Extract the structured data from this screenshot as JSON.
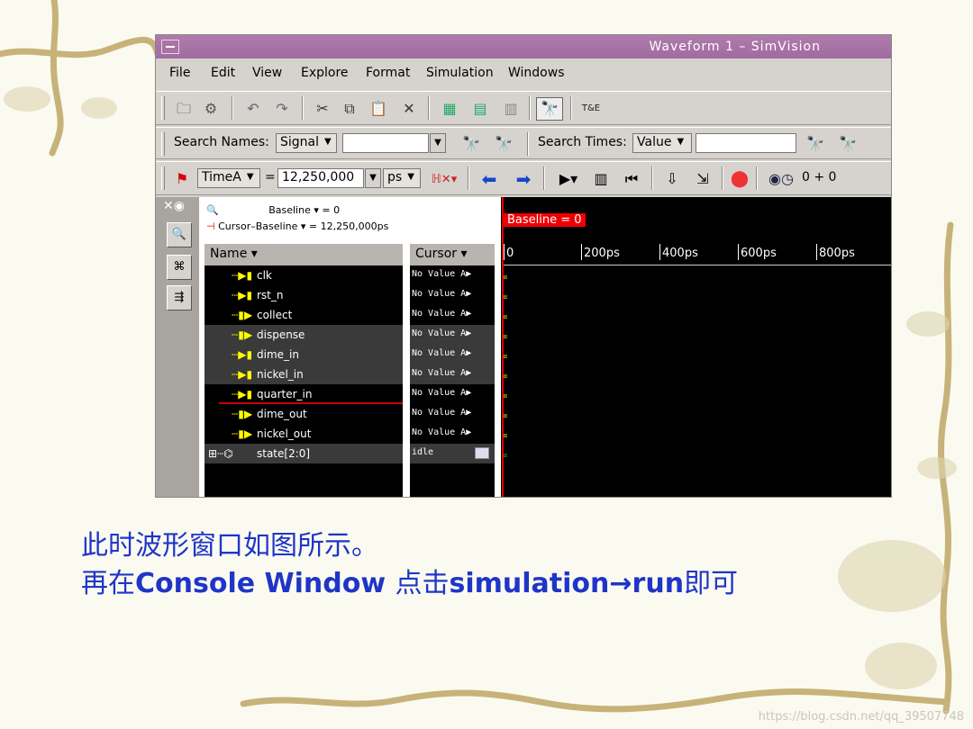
{
  "window": {
    "title": "Waveform 1 – SimVision",
    "menu": [
      "File",
      "Edit",
      "View",
      "Explore",
      "Format",
      "Simulation",
      "Windows"
    ]
  },
  "search": {
    "names_label": "Search Names:",
    "names_type": "Signal",
    "times_label": "Search Times:",
    "times_type": "Value"
  },
  "time": {
    "marker": "TimeA",
    "equals": "=",
    "value": "12,250,000",
    "unit": "ps",
    "offset": "0 + 0"
  },
  "info": {
    "baseline": "Baseline ▾ = 0",
    "cursor_baseline": "Cursor–Baseline ▾ = 12,250,000ps"
  },
  "columns": {
    "name": "Name ▾",
    "cursor": "Cursor ▾"
  },
  "signals": [
    {
      "name": "clk",
      "value": "No Value A▶"
    },
    {
      "name": "rst_n",
      "value": "No Value A▶"
    },
    {
      "name": "collect",
      "value": "No Value A▶"
    },
    {
      "name": "dispense",
      "value": "No Value A▶"
    },
    {
      "name": "dime_in",
      "value": "No Value A▶"
    },
    {
      "name": "nickel_in",
      "value": "No Value A▶"
    },
    {
      "name": "quarter_in",
      "value": "No Value A▶"
    },
    {
      "name": "dime_out",
      "value": "No Value A▶"
    },
    {
      "name": "nickel_out",
      "value": "No Value A▶"
    },
    {
      "name": "state[2:0]",
      "value": "idle"
    }
  ],
  "wave": {
    "baseline_badge": "Baseline = 0",
    "ticks": [
      "0",
      "200ps",
      "400ps",
      "600ps",
      "800ps"
    ]
  },
  "caption": {
    "line1": "此时波形窗口如图所示。",
    "line2_prefix": "再在",
    "line2_bold1": "Console Window ",
    "line2_mid": "点击",
    "line2_bold2": "simulation",
    "line2_arrow": "→",
    "line2_bold3": "run",
    "line2_suffix": "即可"
  },
  "watermark": "https://blog.csdn.net/qq_39507748"
}
